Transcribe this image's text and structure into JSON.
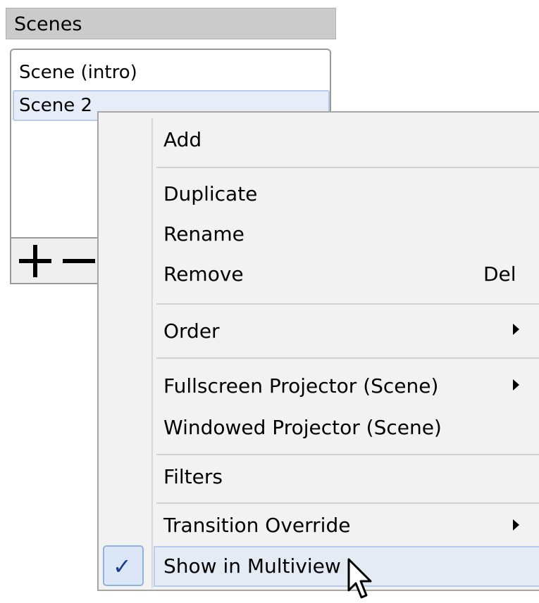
{
  "dock": {
    "title": "Scenes"
  },
  "scenes": {
    "items": [
      {
        "label": "Scene (intro)",
        "selected": false
      },
      {
        "label": "Scene 2",
        "selected": true
      }
    ]
  },
  "toolbar": {
    "add_icon": "plus-icon",
    "remove_icon": "minus-icon"
  },
  "context_menu": {
    "add": "Add",
    "duplicate": "Duplicate",
    "rename": "Rename",
    "remove": "Remove",
    "remove_shortcut": "Del",
    "order": "Order",
    "fullscreen_projector": "Fullscreen Projector (Scene)",
    "windowed_projector": "Windowed Projector (Scene)",
    "filters": "Filters",
    "transition_override": "Transition Override",
    "show_in_multiview": "Show in Multiview",
    "check_glyph": "✓",
    "show_in_multiview_checked": true
  },
  "colors": {
    "highlight": "#e5ebf5",
    "check": "#1a3f8a",
    "menu_bg": "#f2f2f2",
    "header_bg": "#cbcbcb"
  }
}
